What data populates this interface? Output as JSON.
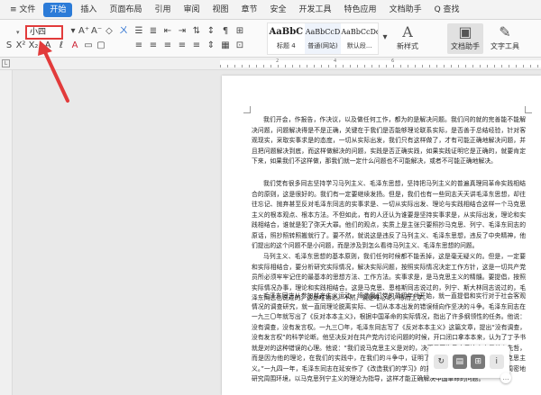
{
  "tabs": [
    {
      "label": "≡ 文件"
    },
    {
      "label": "开始",
      "active": true
    },
    {
      "label": "插入"
    },
    {
      "label": "页面布局"
    },
    {
      "label": "引用"
    },
    {
      "label": "审阅"
    },
    {
      "label": "视图"
    },
    {
      "label": "章节"
    },
    {
      "label": "安全"
    },
    {
      "label": "开发工具"
    },
    {
      "label": "特色应用"
    },
    {
      "label": "文档助手"
    },
    {
      "label": "Q 查找"
    }
  ],
  "ribbon": {
    "font_size_value": "小四",
    "styles": [
      {
        "sample": "AaBbC",
        "label": "标题 4"
      },
      {
        "sample": "AaBbCcD",
        "label": "普通(网站)"
      },
      {
        "sample": "AaBbCcDd",
        "label": "默认段..."
      }
    ],
    "new_style_label": "新样式",
    "doc_helper_label": "文档助手",
    "text_tools_label": "文字工具"
  },
  "ruler": {
    "numbers": [
      "2",
      "4",
      "6"
    ]
  },
  "document": {
    "paragraphs": [
      "我们开会，作报告，作决议，以及做任何工作，都为的是解决问题。我们问的就的完善能不能解决问题，问题解决得是不是正确，关键在于我们是否能够理论联系实际，是否善于总结经验，针对客观现实，采取实事求是的态度，一切从实际出发，我们只有这样做了，才有可能正确地解决问题，并且把问题解决到底，而这样做解决的问题，实践是否正确实践，如果实践证明它是正确的，就要肯定下来，如果我们不这样做，那我们就一定什么问题也不可能解决，或者不可能正确地解决。",
      "我们党有很多同志坚持学习马列主义、毛泽东思想，坚持把马列主义的普遍真理同革命实践相结合的原则，这是很好的。我们有一定要继续发扬。但是，我们也有一些同志天天讲毛泽东思想，却往往忘记、抛弃甚至反对毛泽东同志的实事求是、一切从实际出发、理论与实践相结合这样一个马克思主义的根本观点、根本方法。不但如此，有的人还认为谁要是坚持实事求是，从实际出发，理论和实践相结合，谁就是犯了弥天大罪。他们的观点，实质上是主张只要照抄马克思、列宁、毛泽东同志的原话，照抄照转照搬就行了。要不然，就说这是违反了马列主义、毛泽东思想，违反了中央精神，他们提出的这个问题不是小问题，而是涉及到怎么看待马列主义、毛泽东思想的问题。",
      "马列主义、毛泽东思想的基本原则，我们任何时候都不能丢掉，这是毫无疑义的。但是，一定要和实际相结合，要分析研究实际情况，解决实际问题，按照实际情况决定工作方针，这是一切共产党员所必须牢牢记住的最基本的思想方法、工作方法。实事求是，是马克思主义的精髓。要提倡，按照实际情况办事，理论和实践相结合。这是马克思、恩格斯同志说过的，列宁、斯大林同志说过的，毛泽东同志也说过的。这是唯物论。不然，就是唯心论，形而上学。",
      "毛泽东同志从参加共产主义运动、缔造我们党的最初年代开始，就一直提倡和实行对于社会客观情况的调查研究，就一直同理论脱离实际、一切从本本出发的错误倾向作坚决的斗争。毛泽东同志在一九三〇年就写出了《反对本本主义》，根据中国革命的实际情况，指出了许多纲领性的任务。他说：没有调查，没有发言权。一九三〇年，毛泽东同志写了《反对本本主义》这篇文章，提出“没有调查，没有发言权”的科学论断。他坚决反对在共产党内讨论问题的时候，开口闭口拿本本来，认为了丁予书就是对的这种错误的心理。他说：“我们说马克思主义是对的，决不是因为马克思这个人是什么先哲，而是因为他的理论，在我们的实践中，在我们的斗争中，证明了是对的。我们的斗争需要马克思主义。”一九四一年，毛泽东同志在延安作了《改造我们的学习》的报告。他指出，我们要系统地周密地研究周围环境，以马克思列宁主义的理论为指导，这样才能正确解决中国革命的问题。"
    ]
  },
  "float_toolbar": {
    "icons": [
      "refresh-icon",
      "doc-icon",
      "grid-icon",
      "info-icon"
    ],
    "tip": "…"
  }
}
